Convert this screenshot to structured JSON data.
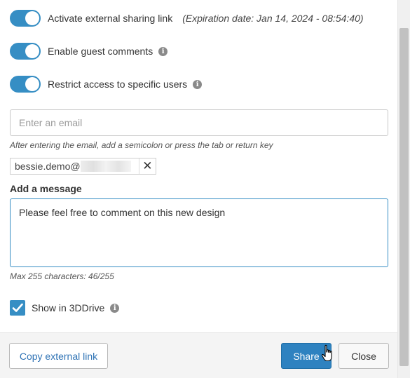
{
  "sharing": {
    "external_link": {
      "label": "Activate external sharing link",
      "expiration": "(Expiration date: Jan 14, 2024 - 08:54:40)",
      "enabled": true
    },
    "guest_comments": {
      "label": "Enable guest comments",
      "enabled": true,
      "info_icon": "info-icon"
    },
    "restrict_access": {
      "label": "Restrict access to specific users",
      "enabled": true,
      "info_icon": "info-icon"
    }
  },
  "email": {
    "placeholder": "Enter an email",
    "value": "",
    "hint": "After entering the email, add a semicolon or press the tab or return key",
    "chips": [
      {
        "text": "bessie.demo@",
        "remove_icon": "close-icon"
      }
    ]
  },
  "message": {
    "label": "Add a message",
    "value": "Please feel free to comment on this new design",
    "counter": "Max 255 characters: 46/255"
  },
  "show_in_3ddrive": {
    "label": "Show in 3DDrive",
    "checked": true,
    "info_icon": "info-icon"
  },
  "footer": {
    "copy_link_label": "Copy external link",
    "share_label": "Share",
    "close_label": "Close"
  },
  "colors": {
    "accent": "#368ec4",
    "link": "#2f73b5"
  }
}
